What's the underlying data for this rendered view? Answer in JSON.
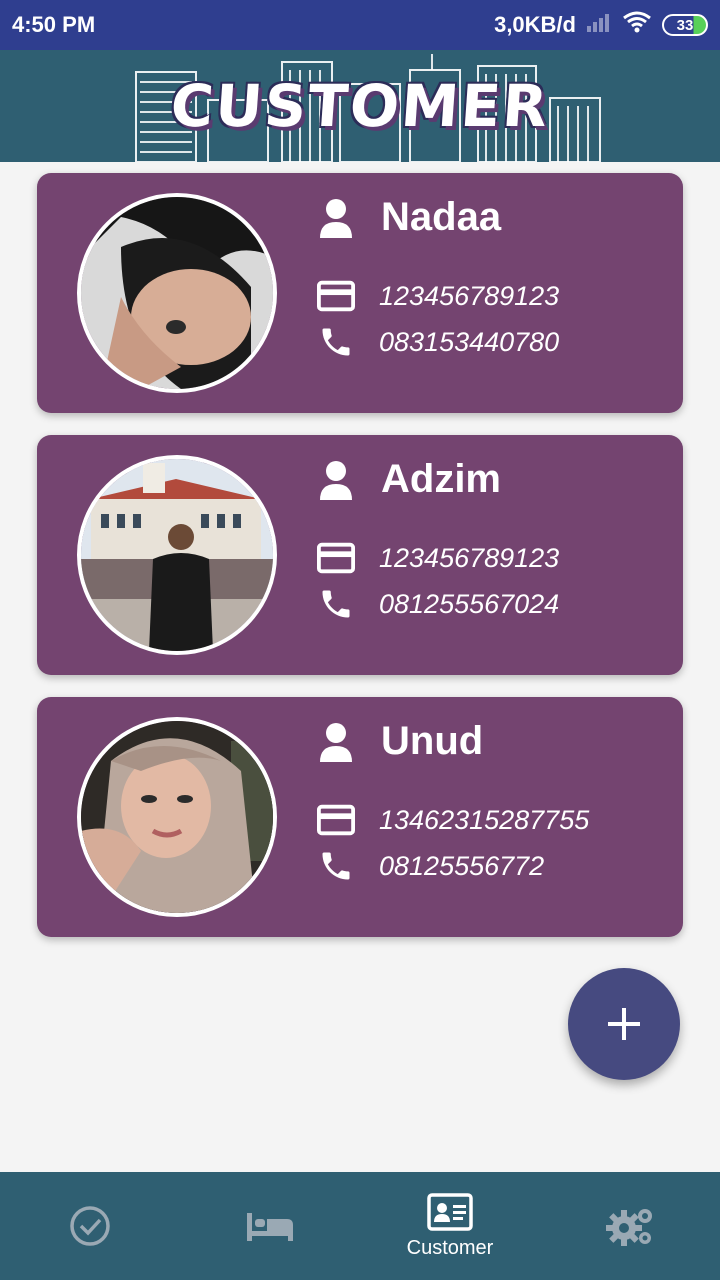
{
  "status_bar": {
    "time": "4:50 PM",
    "network_speed": "3,0KB/d",
    "battery_level": "33"
  },
  "header": {
    "title": "CUSTOMER"
  },
  "customers": [
    {
      "name": "Nadaa",
      "id_number": "123456789123",
      "phone": "083153440780"
    },
    {
      "name": "Adzim",
      "id_number": "123456789123",
      "phone": "081255567024"
    },
    {
      "name": "Unud",
      "id_number": "13462315287755",
      "phone": "08125556772"
    }
  ],
  "fab": {
    "icon": "plus-icon"
  },
  "bottom_nav": {
    "items": [
      {
        "icon": "check-circle-icon",
        "label": ""
      },
      {
        "icon": "bed-icon",
        "label": ""
      },
      {
        "icon": "id-card-icon",
        "label": "Customer"
      },
      {
        "icon": "gears-icon",
        "label": ""
      }
    ],
    "active_index": 2
  },
  "colors": {
    "status_bar": "#2f3e8f",
    "header": "#2f5f72",
    "card": "#744470",
    "fab": "#464a80",
    "background": "#f4f4f4"
  }
}
